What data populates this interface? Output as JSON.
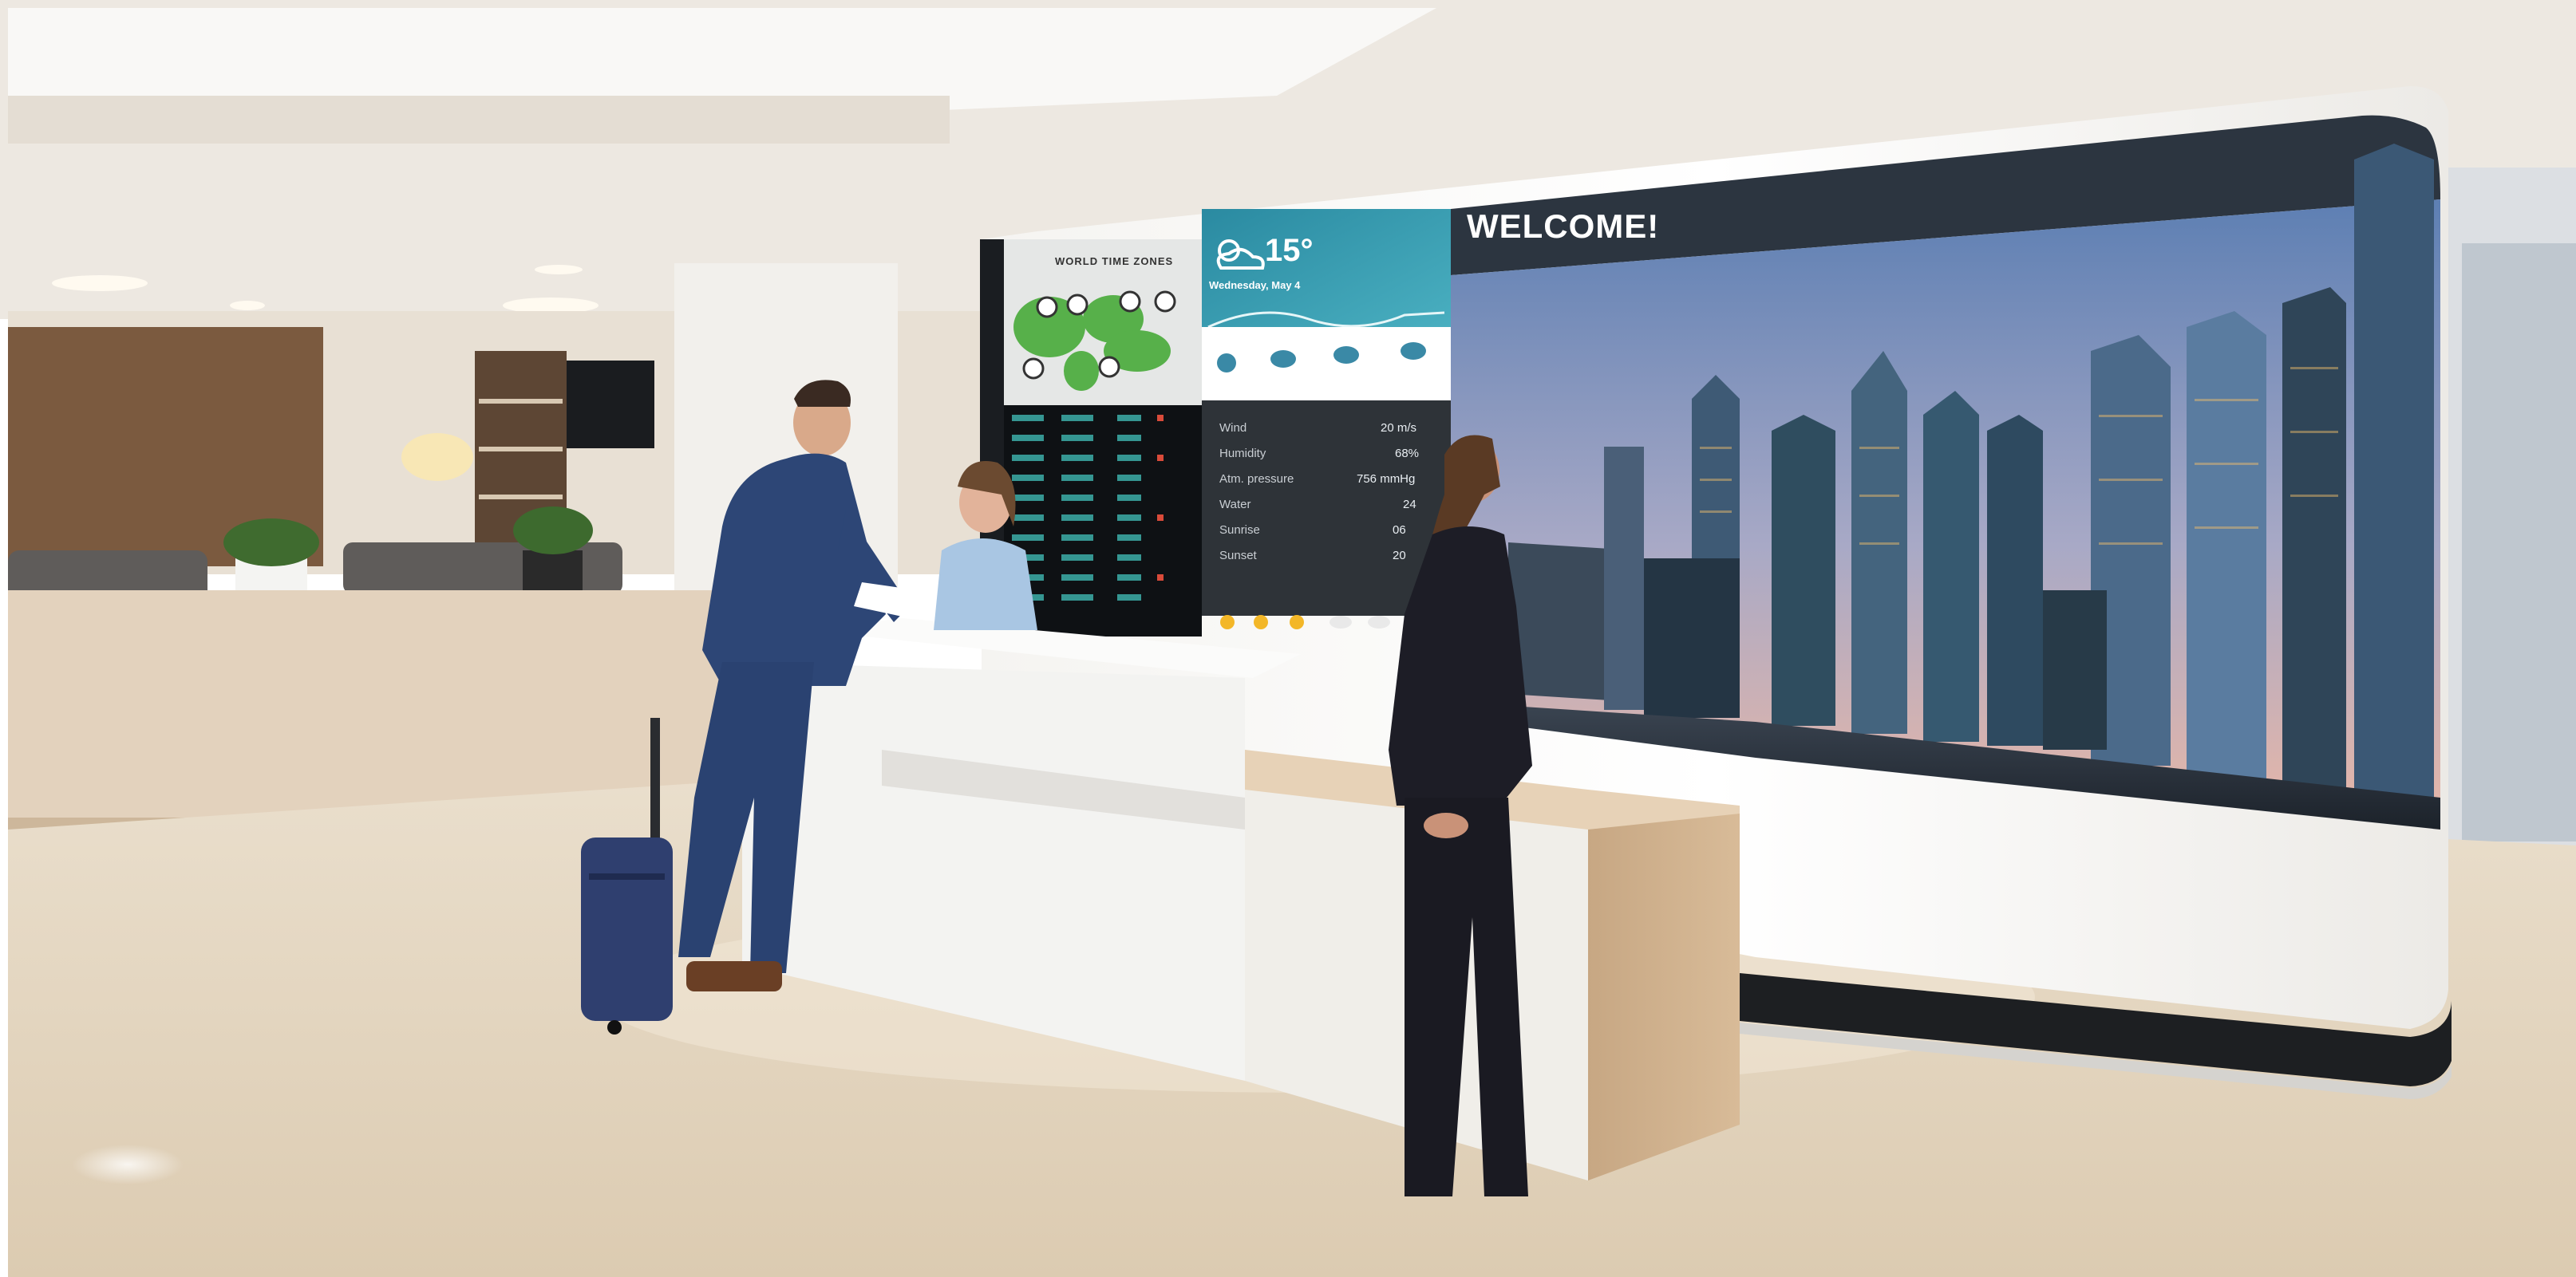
{
  "signage": {
    "world_clock_title": "WORLD TIME ZONES",
    "weather": {
      "temperature": "15°",
      "date": "Wednesday, May 4",
      "details": [
        {
          "label": "Wind",
          "value": "20 m/s"
        },
        {
          "label": "Humidity",
          "value": "68%"
        },
        {
          "label": "Atm. pressure",
          "value": "756 mmHg"
        },
        {
          "label": "Water",
          "value": "24"
        },
        {
          "label": "Sunrise",
          "value": "06"
        },
        {
          "label": "Sunset",
          "value": "20"
        }
      ]
    },
    "welcome_text": "WELCOME!"
  },
  "colors": {
    "ceiling": "#f1ede7",
    "floor": "#e4d6c0",
    "wall_panel": "#7a5a3e",
    "counter": "#f4f4f2",
    "wood": "#cdae8a",
    "suit": "#2d4676",
    "screen_header": "#2c3540",
    "weather_teal": "#2f93a8",
    "sky_top": "#6d8fbf",
    "sky_bottom": "#e3b3a8",
    "dark_panel": "#111418"
  }
}
